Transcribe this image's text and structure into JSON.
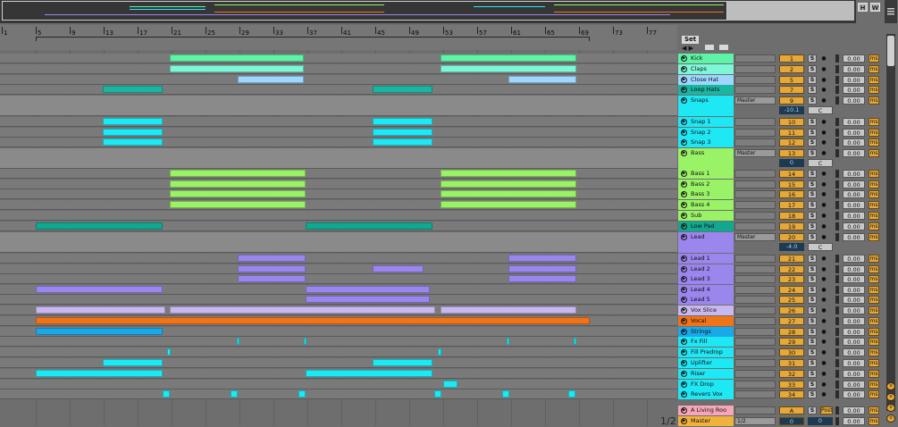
{
  "overview": {
    "hide_btn": "H",
    "wrap_btn": "W"
  },
  "ruler": {
    "bars": [
      "1",
      "5",
      "9",
      "13",
      "17",
      "21",
      "25",
      "29",
      "33",
      "37",
      "41",
      "45",
      "49",
      "53",
      "57",
      "61",
      "65",
      "69",
      "73",
      "77"
    ]
  },
  "mixer": {
    "set_label": "Set"
  },
  "tracks": [
    {
      "name": "Kick",
      "color": "#5ef3a6",
      "num": "1",
      "delay": "0.00",
      "unit": "ms",
      "arm": "●",
      "solo": "S"
    },
    {
      "name": "Claps",
      "color": "#7ef7d8",
      "num": "2",
      "delay": "0.00",
      "unit": "ms",
      "arm": "●",
      "solo": "S"
    },
    {
      "name": "Close Hat",
      "color": "#9dd7ff",
      "num": "5",
      "delay": "0.00",
      "unit": "ms",
      "arm": "●",
      "solo": "S"
    },
    {
      "name": "Loop Hats",
      "color": "#1ab6a0",
      "num": "7",
      "delay": "0.00",
      "unit": "ms",
      "arm": "●",
      "solo": "S"
    },
    {
      "name": "Snaps",
      "color": "#1fe8f5",
      "num": "9",
      "delay": "0.00",
      "unit": "ms",
      "arm": "●",
      "solo": "S",
      "route": "Master",
      "vol": "-10.1",
      "pan": "C"
    },
    {
      "name": "Snap 1",
      "color": "#1fe8f5",
      "num": "10",
      "delay": "0.00",
      "unit": "ms",
      "arm": "●",
      "solo": "S"
    },
    {
      "name": "Snap 2",
      "color": "#1fe8f5",
      "num": "11",
      "delay": "0.00",
      "unit": "ms",
      "arm": "●",
      "solo": "S"
    },
    {
      "name": "Snap 3",
      "color": "#1fe8f5",
      "num": "12",
      "delay": "0.00",
      "unit": "ms",
      "arm": "●",
      "solo": "S"
    },
    {
      "name": "Bass",
      "color": "#9af266",
      "num": "13",
      "delay": "0.00",
      "unit": "ms",
      "arm": "●",
      "solo": "S",
      "route": "Master",
      "vol": "0",
      "pan": "C"
    },
    {
      "name": "Bass 1",
      "color": "#9af266",
      "num": "14",
      "delay": "0.00",
      "unit": "ms",
      "arm": "●",
      "solo": "S"
    },
    {
      "name": "Bass 2",
      "color": "#9af266",
      "num": "15",
      "delay": "0.00",
      "unit": "ms",
      "arm": "●",
      "solo": "S"
    },
    {
      "name": "Bass 3",
      "color": "#9af266",
      "num": "16",
      "delay": "0.00",
      "unit": "ms",
      "arm": "●",
      "solo": "S"
    },
    {
      "name": "Bass 4",
      "color": "#9af266",
      "num": "17",
      "delay": "0.00",
      "unit": "ms",
      "arm": "●",
      "solo": "S"
    },
    {
      "name": "Sub",
      "color": "#9af266",
      "num": "18",
      "delay": "0.00",
      "unit": "ms",
      "arm": "●",
      "solo": "S"
    },
    {
      "name": "Low Pad",
      "color": "#10a890",
      "num": "19",
      "delay": "0.00",
      "unit": "ms",
      "arm": "●",
      "solo": "S"
    },
    {
      "name": "Lead",
      "color": "#9b86ee",
      "num": "20",
      "delay": "0.00",
      "unit": "ms",
      "arm": "●",
      "solo": "S",
      "route": "Master",
      "vol": "-4.0",
      "pan": "C"
    },
    {
      "name": "Lead 1",
      "color": "#9b86ee",
      "num": "21",
      "delay": "0.00",
      "unit": "ms",
      "arm": "●",
      "solo": "S"
    },
    {
      "name": "Lead 2",
      "color": "#9b86ee",
      "num": "22",
      "delay": "0.00",
      "unit": "ms",
      "arm": "●",
      "solo": "S"
    },
    {
      "name": "Lead 3",
      "color": "#9b86ee",
      "num": "23",
      "delay": "0.00",
      "unit": "ms",
      "arm": "●",
      "solo": "S"
    },
    {
      "name": "Lead 4",
      "color": "#9b86ee",
      "num": "24",
      "delay": "0.00",
      "unit": "ms",
      "arm": "●",
      "solo": "S"
    },
    {
      "name": "Lead 5",
      "color": "#9b86ee",
      "num": "25",
      "delay": "0.00",
      "unit": "ms",
      "arm": "●",
      "solo": "S"
    },
    {
      "name": "Vox Slice",
      "color": "#c9b8f0",
      "num": "26",
      "delay": "0.00",
      "unit": "ms",
      "arm": "●",
      "solo": "S"
    },
    {
      "name": "Vocal",
      "color": "#f07318",
      "num": "27",
      "delay": "0.00",
      "unit": "ms",
      "arm": "●",
      "solo": "S"
    },
    {
      "name": "Strings",
      "color": "#1aa8e8",
      "num": "28",
      "delay": "0.00",
      "unit": "ms",
      "arm": "●",
      "solo": "S"
    },
    {
      "name": "Fx Fill",
      "color": "#1fe8f5",
      "num": "29",
      "delay": "0.00",
      "unit": "ms",
      "arm": "●",
      "solo": "S"
    },
    {
      "name": "Fill Predrop",
      "color": "#1fe8f5",
      "num": "30",
      "delay": "0.00",
      "unit": "ms",
      "arm": "●",
      "solo": "S"
    },
    {
      "name": "Uplifter",
      "color": "#1fe8f5",
      "num": "31",
      "delay": "0.00",
      "unit": "ms",
      "arm": "●",
      "solo": "S"
    },
    {
      "name": "Riser",
      "color": "#1fe8f5",
      "num": "32",
      "delay": "0.00",
      "unit": "ms",
      "arm": "●",
      "solo": "S"
    },
    {
      "name": "FX Drop",
      "color": "#1fe8f5",
      "num": "33",
      "delay": "0.00",
      "unit": "ms",
      "arm": "●",
      "solo": "S"
    },
    {
      "name": "Revers Vox",
      "color": "#1fe8f5",
      "num": "34",
      "delay": "0.00",
      "unit": "ms",
      "arm": "●",
      "solo": "S"
    }
  ],
  "returns": [
    {
      "name": "A Living Roo",
      "color": "#f7a6b8",
      "num": "A",
      "delay": "0.00",
      "unit": "ms",
      "solo": "S",
      "post": "Post"
    },
    {
      "name": "Master",
      "color": "#f0b23a",
      "num": "0",
      "delay": "0.00",
      "unit": "ms",
      "route": "1/2",
      "pan": "0"
    }
  ],
  "page_indicator": "1/2"
}
